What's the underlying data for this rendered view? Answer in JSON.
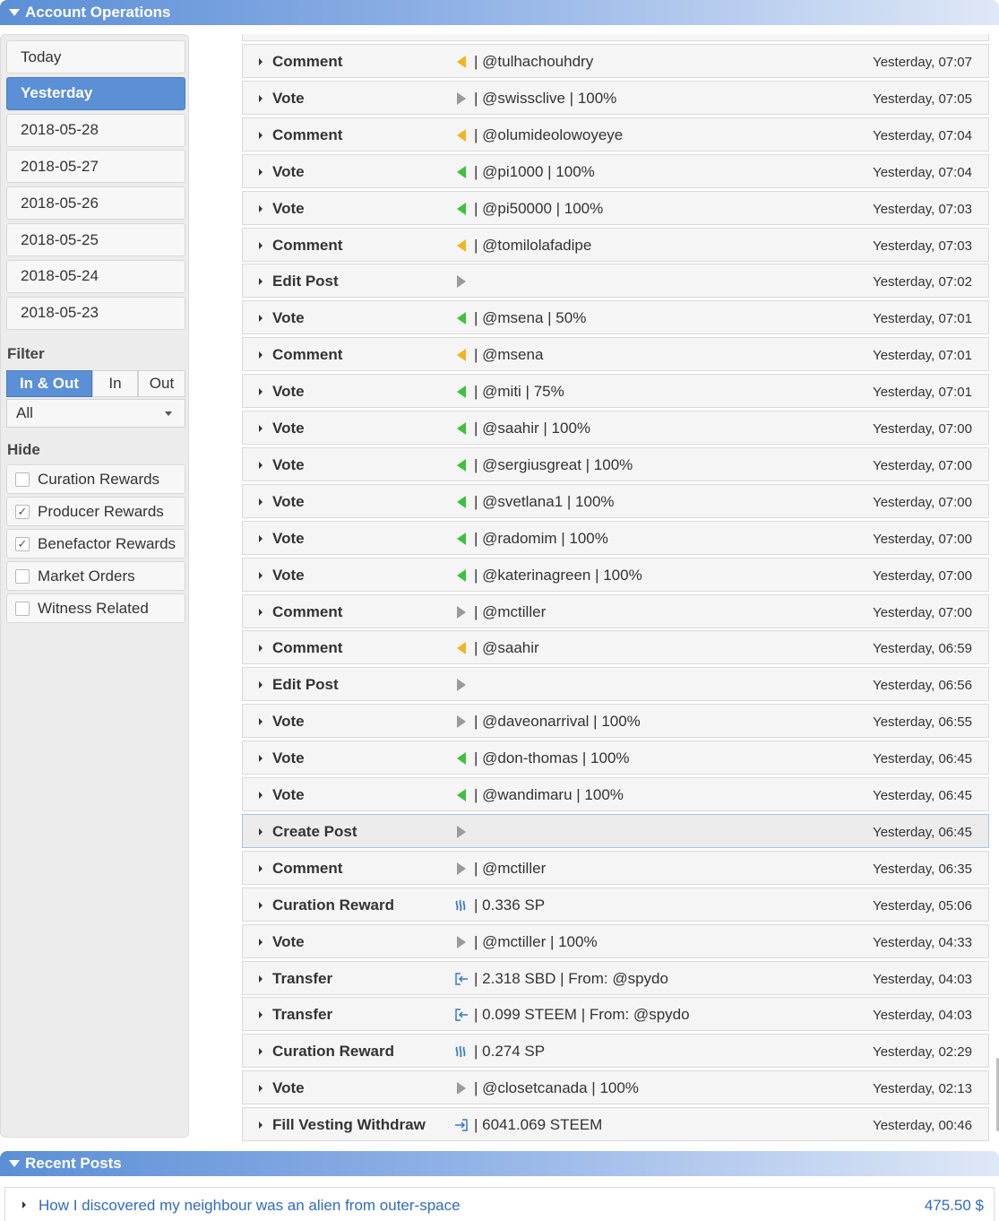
{
  "account_operations": {
    "title": "Account Operations",
    "days": [
      "Today",
      "Yesterday",
      "2018-05-28",
      "2018-05-27",
      "2018-05-26",
      "2018-05-25",
      "2018-05-24",
      "2018-05-23"
    ],
    "selected_day": "Yesterday",
    "filter": {
      "label": "Filter",
      "direction_options": [
        "In & Out",
        "In",
        "Out"
      ],
      "selected_direction": "In & Out",
      "type_select": "All"
    },
    "hide": {
      "label": "Hide",
      "options": [
        {
          "label": "Curation Rewards",
          "checked": false
        },
        {
          "label": "Producer Rewards",
          "checked": true
        },
        {
          "label": "Benefactor Rewards",
          "checked": true
        },
        {
          "label": "Market Orders",
          "checked": false
        },
        {
          "label": "Witness Related",
          "checked": false
        }
      ]
    },
    "operations": [
      {
        "type": "Comment",
        "icon": "outgoing-orange-icon",
        "detail": "| @tulhachouhdry",
        "time": "Yesterday, 07:07"
      },
      {
        "type": "Vote",
        "icon": "incoming-gray-icon",
        "detail": "| @swissclive | 100%",
        "time": "Yesterday, 07:05"
      },
      {
        "type": "Comment",
        "icon": "outgoing-orange-icon",
        "detail": "| @olumideolowoyeye",
        "time": "Yesterday, 07:04"
      },
      {
        "type": "Vote",
        "icon": "outgoing-green-icon",
        "detail": "| @pi1000 | 100%",
        "time": "Yesterday, 07:04"
      },
      {
        "type": "Vote",
        "icon": "outgoing-green-icon",
        "detail": "| @pi50000 | 100%",
        "time": "Yesterday, 07:03"
      },
      {
        "type": "Comment",
        "icon": "outgoing-orange-icon",
        "detail": "| @tomilolafadipe",
        "time": "Yesterday, 07:03"
      },
      {
        "type": "Edit Post",
        "icon": "incoming-gray-icon",
        "detail": "",
        "time": "Yesterday, 07:02"
      },
      {
        "type": "Vote",
        "icon": "outgoing-green-icon",
        "detail": "| @msena | 50%",
        "time": "Yesterday, 07:01"
      },
      {
        "type": "Comment",
        "icon": "outgoing-orange-icon",
        "detail": "| @msena",
        "time": "Yesterday, 07:01"
      },
      {
        "type": "Vote",
        "icon": "outgoing-green-icon",
        "detail": "| @miti | 75%",
        "time": "Yesterday, 07:01"
      },
      {
        "type": "Vote",
        "icon": "outgoing-green-icon",
        "detail": "| @saahir | 100%",
        "time": "Yesterday, 07:00"
      },
      {
        "type": "Vote",
        "icon": "outgoing-green-icon",
        "detail": "| @sergiusgreat | 100%",
        "time": "Yesterday, 07:00"
      },
      {
        "type": "Vote",
        "icon": "outgoing-green-icon",
        "detail": "| @svetlana1 | 100%",
        "time": "Yesterday, 07:00"
      },
      {
        "type": "Vote",
        "icon": "outgoing-green-icon",
        "detail": "| @radomim | 100%",
        "time": "Yesterday, 07:00"
      },
      {
        "type": "Vote",
        "icon": "outgoing-green-icon",
        "detail": "| @katerinagreen | 100%",
        "time": "Yesterday, 07:00"
      },
      {
        "type": "Comment",
        "icon": "incoming-gray-icon",
        "detail": "| @mctiller",
        "time": "Yesterday, 07:00"
      },
      {
        "type": "Comment",
        "icon": "outgoing-orange-icon",
        "detail": "| @saahir",
        "time": "Yesterday, 06:59"
      },
      {
        "type": "Edit Post",
        "icon": "incoming-gray-icon",
        "detail": "",
        "time": "Yesterday, 06:56"
      },
      {
        "type": "Vote",
        "icon": "incoming-gray-icon",
        "detail": "| @daveonarrival | 100%",
        "time": "Yesterday, 06:55"
      },
      {
        "type": "Vote",
        "icon": "outgoing-green-icon",
        "detail": "| @don-thomas | 100%",
        "time": "Yesterday, 06:45"
      },
      {
        "type": "Vote",
        "icon": "outgoing-green-icon",
        "detail": "| @wandimaru | 100%",
        "time": "Yesterday, 06:45"
      },
      {
        "type": "Create Post",
        "icon": "incoming-gray-icon",
        "detail": "",
        "time": "Yesterday, 06:45",
        "highlighted": true
      },
      {
        "type": "Comment",
        "icon": "incoming-gray-icon",
        "detail": "| @mctiller",
        "time": "Yesterday, 06:35"
      },
      {
        "type": "Curation Reward",
        "icon": "steem-logo-icon",
        "detail": "| 0.336 SP",
        "time": "Yesterday, 05:06"
      },
      {
        "type": "Vote",
        "icon": "incoming-gray-icon",
        "detail": "| @mctiller | 100%",
        "time": "Yesterday, 04:33"
      },
      {
        "type": "Transfer",
        "icon": "transfer-in-icon",
        "detail": "| 2.318 SBD | From: @spydo",
        "time": "Yesterday, 04:03"
      },
      {
        "type": "Transfer",
        "icon": "transfer-in-icon",
        "detail": "| 0.099 STEEM | From: @spydo",
        "time": "Yesterday, 04:03"
      },
      {
        "type": "Curation Reward",
        "icon": "steem-logo-icon",
        "detail": "| 0.274 SP",
        "time": "Yesterday, 02:29"
      },
      {
        "type": "Vote",
        "icon": "incoming-gray-icon",
        "detail": "| @closetcanada | 100%",
        "time": "Yesterday, 02:13"
      },
      {
        "type": "Fill Vesting Withdraw",
        "icon": "withdraw-in-icon",
        "detail": "| 6041.069 STEEM",
        "time": "Yesterday, 00:46"
      }
    ]
  },
  "recent_posts": {
    "title": "Recent Posts",
    "items": [
      {
        "title": "How I discovered my neighbour was an alien from outer-space",
        "value": "475.50 $"
      }
    ]
  },
  "colors": {
    "accent": "#5b8fd6",
    "vote_out": "#3ec13e",
    "comment_out": "#f0b522",
    "incoming": "#9a9a9a",
    "link": "#2f6bbf"
  }
}
